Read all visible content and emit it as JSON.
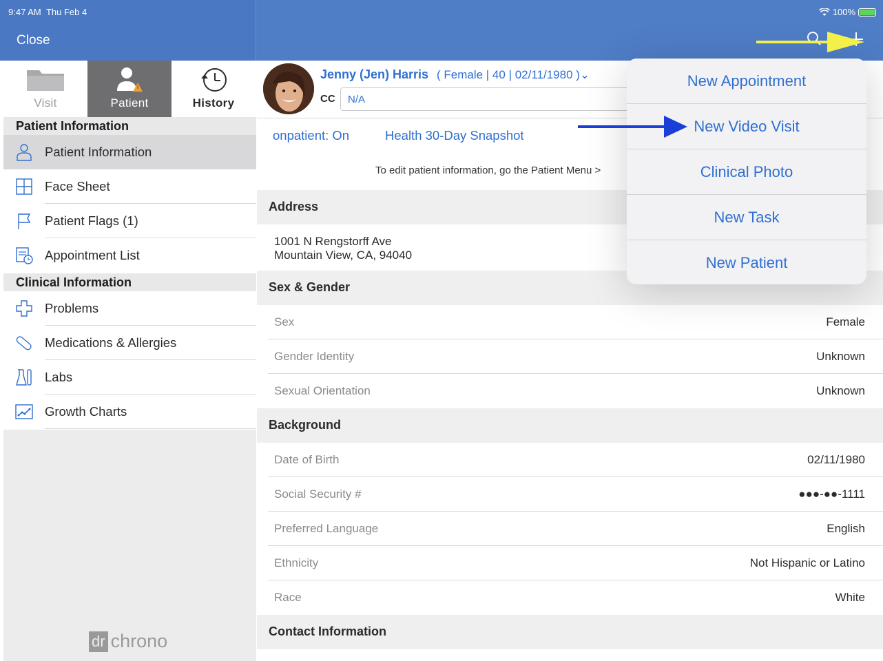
{
  "status_bar": {
    "time": "9:47 AM",
    "date": "Thu Feb 4",
    "battery": "100%"
  },
  "nav": {
    "close_label": "Close",
    "search_icon": "search-icon",
    "add_icon": "plus-icon"
  },
  "segments": [
    {
      "label": "Visit",
      "icon": "folder-icon"
    },
    {
      "label": "Patient",
      "icon": "patient-warning-icon"
    },
    {
      "label": "History",
      "icon": "history-clock-icon"
    }
  ],
  "sidebar": {
    "patient_section": "Patient Information",
    "patient_items": [
      "Patient Information",
      "Face Sheet",
      "Patient Flags (1)",
      "Appointment List"
    ],
    "clinical_section": "Clinical Information",
    "clinical_items": [
      "Problems",
      "Medications & Allergies",
      "Labs",
      "Growth Charts"
    ],
    "logo_mark": "dr",
    "logo_word": "chrono"
  },
  "patient": {
    "name": "Jenny (Jen) Harris",
    "demographics": "( Female | 40 | 02/11/1980 )⌄",
    "cc_label": "CC",
    "cc_value": "N/A"
  },
  "links": {
    "onpatient": "onpatient: On",
    "snapshot": "Health 30-Day Snapshot"
  },
  "edit_note": "To edit patient information, go the Patient Menu >",
  "sections": {
    "address_header": "Address",
    "address_line1": "1001 N Rengstorff Ave",
    "address_line2": "Mountain View, CA, 94040",
    "sex_gender_header": "Sex & Gender",
    "sex_gender_rows": [
      {
        "k": "Sex",
        "v": "Female"
      },
      {
        "k": "Gender Identity",
        "v": "Unknown"
      },
      {
        "k": "Sexual Orientation",
        "v": "Unknown"
      }
    ],
    "background_header": "Background",
    "background_rows": [
      {
        "k": "Date of Birth",
        "v": "02/11/1980"
      },
      {
        "k": "Social Security #",
        "v": "●●●-●●-1111"
      },
      {
        "k": "Preferred Language",
        "v": "English"
      },
      {
        "k": "Ethnicity",
        "v": "Not Hispanic or Latino"
      },
      {
        "k": "Race",
        "v": "White"
      }
    ],
    "contact_header": "Contact Information"
  },
  "popover": [
    "New Appointment",
    "New Video Visit",
    "Clinical Photo",
    "New Task",
    "New Patient"
  ],
  "colors": {
    "nav_blue": "#4f7dc6",
    "link_blue": "#2f6fd1",
    "highlight_yellow": "#f4f04a",
    "arrow_blue": "#1a3fd6"
  }
}
